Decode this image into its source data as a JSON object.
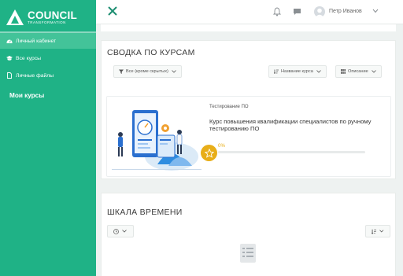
{
  "brand": {
    "name": "COUNCIL",
    "tagline": "TRANSFORMATION"
  },
  "sidebar": {
    "items": [
      {
        "label": "Личный кабинет",
        "icon": "dashboard-icon",
        "active": true
      },
      {
        "label": "Все курсы",
        "icon": "courses-icon",
        "active": false
      },
      {
        "label": "Личные файлы",
        "icon": "file-icon",
        "active": false
      }
    ],
    "my_courses_heading": "Мои курсы"
  },
  "header": {
    "user_name": "Петр Иванов",
    "icons": [
      "close-icon",
      "bell-icon",
      "chat-icon",
      "avatar",
      "chevron-down-icon"
    ]
  },
  "overview": {
    "title": "СВОДКА ПО КУРСАМ",
    "filter_label": "Все (кроме скрытых)",
    "sort_label": "Название курса",
    "view_label": "Описание",
    "course": {
      "category": "Тестирование ПО",
      "name": "Курс повышения квалификации специалистов по ручному тестированию ПО",
      "progress_text": "0%",
      "progress": 0
    }
  },
  "timeline": {
    "title": "ШКАЛА ВРЕМЕНИ"
  },
  "colors": {
    "brand_green": "#1fb286",
    "active_item": "#43c399",
    "progress_accent": "#e8ae19"
  }
}
